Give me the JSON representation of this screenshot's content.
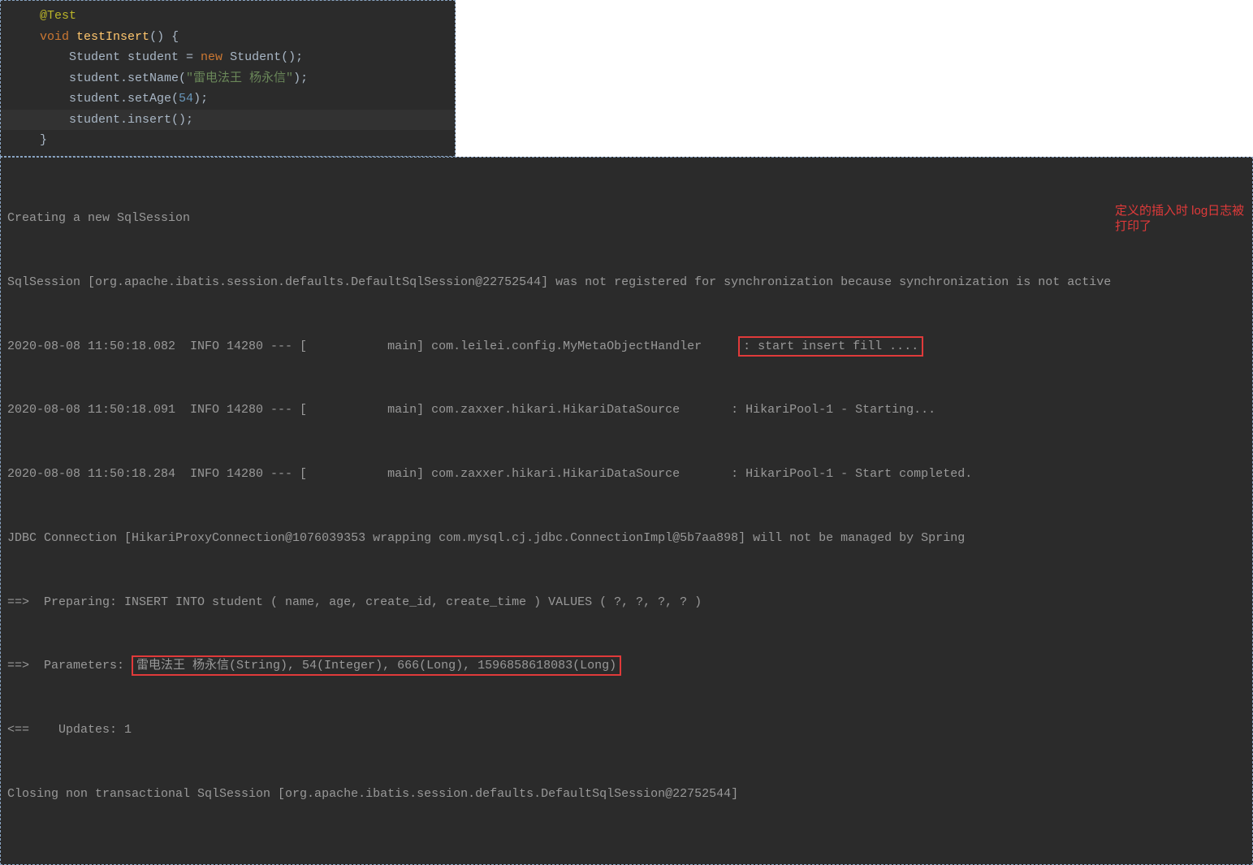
{
  "code": {
    "indent1": "    ",
    "indent2": "        ",
    "annotation": "@Test",
    "kw_void": "void",
    "fn_name": "testInsert",
    "paren_open": "() {",
    "line2_a": "Student student = ",
    "kw_new": "new",
    "line2_b": " Student();",
    "line3_a": "student.setName(",
    "str_name": "\"雷电法王 杨永信\"",
    "line3_b": ");",
    "line4_a": "student.setAge(",
    "num_age": "54",
    "line4_b": ");",
    "line5": "student.insert();",
    "close": "}"
  },
  "console": {
    "l1": "Creating a new SqlSession",
    "l2": "SqlSession [org.apache.ibatis.session.defaults.DefaultSqlSession@22752544] was not registered for synchronization because synchronization is not active",
    "l3a": "2020-08-08 11:50:18.082  INFO 14280 --- [           main] com.leilei.config.MyMetaObjectHandler     ",
    "l3box": ": start insert fill ....",
    "l4": "2020-08-08 11:50:18.091  INFO 14280 --- [           main] com.zaxxer.hikari.HikariDataSource       : HikariPool-1 - Starting...",
    "l5": "2020-08-08 11:50:18.284  INFO 14280 --- [           main] com.zaxxer.hikari.HikariDataSource       : HikariPool-1 - Start completed.",
    "l6": "JDBC Connection [HikariProxyConnection@1076039353 wrapping com.mysql.cj.jdbc.ConnectionImpl@5b7aa898] will not be managed by Spring",
    "l7": "==>  Preparing: INSERT INTO student ( name, age, create_id, create_time ) VALUES ( ?, ?, ?, ? ) ",
    "l8a": "==>  Parameters: ",
    "l8box": "雷电法王 杨永信(String), 54(Integer), 666(Long), 1596858618083(Long)",
    "l9": "<==    Updates: 1",
    "l10": "Closing non transactional SqlSession [org.apache.ibatis.session.defaults.DefaultSqlSession@22752544]"
  },
  "annotation": {
    "text": "定义的插入时 log日志被打印了"
  }
}
